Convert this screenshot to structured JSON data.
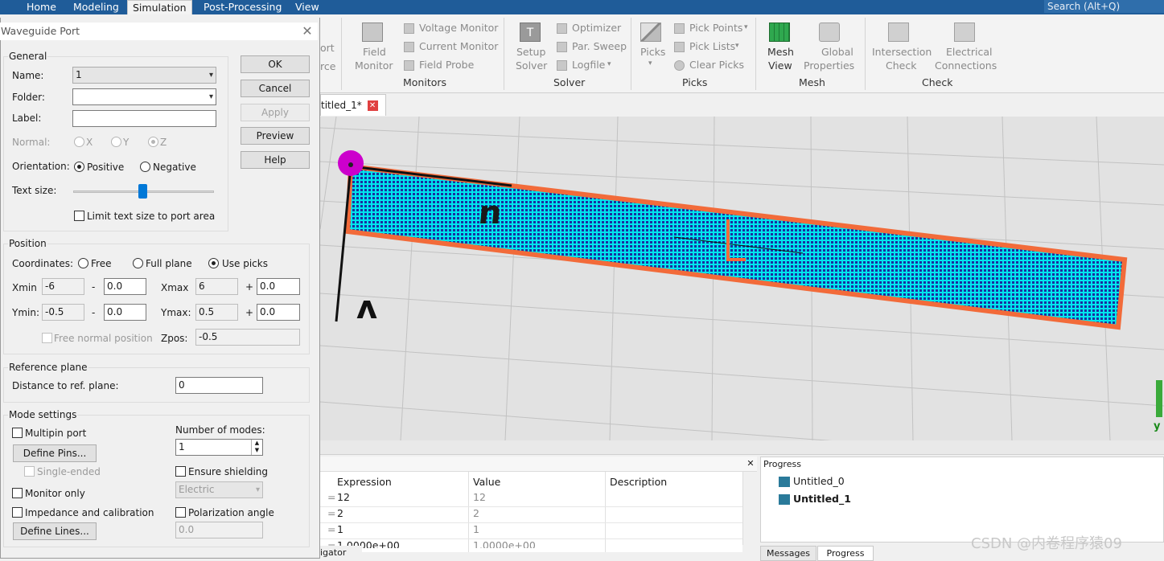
{
  "menubar": {
    "tabs": [
      "Home",
      "Modeling",
      "Simulation",
      "Post-Processing",
      "View"
    ],
    "active_tab": "Simulation",
    "search_placeholder": "Search (Alt+Q)"
  },
  "ribbon": {
    "partial": {
      "port": "ort",
      "source": "rce"
    },
    "field_monitor": {
      "line1": "Field",
      "line2": "Monitor"
    },
    "voltage_monitor": "Voltage Monitor",
    "current_monitor": "Current Monitor",
    "field_probe": "Field Probe",
    "monitors_group": "Monitors",
    "setup_solver": {
      "line1": "Setup",
      "line2": "Solver"
    },
    "optimizer": "Optimizer",
    "par_sweep": "Par. Sweep",
    "logfile": "Logfile",
    "solver_group": "Solver",
    "picks": "Picks",
    "pick_points": "Pick Points",
    "pick_lists": "Pick Lists",
    "clear_picks": "Clear Picks",
    "picks_group": "Picks",
    "mesh_view": {
      "line1": "Mesh",
      "line2": "View"
    },
    "global_properties": {
      "line1": "Global",
      "line2": "Properties"
    },
    "mesh_group": "Mesh",
    "intersection_check": {
      "line1": "Intersection",
      "line2": "Check"
    },
    "electrical_connections": {
      "line1": "Electrical",
      "line2": "Connections"
    },
    "check_group": "Check"
  },
  "document_tab": {
    "label": "titled_1*"
  },
  "viewport": {
    "port_label_n": "n",
    "port_label_wedge": "ʌ",
    "axis_y": "y"
  },
  "dialog": {
    "title": "Waveguide Port",
    "buttons": {
      "ok": "OK",
      "cancel": "Cancel",
      "apply": "Apply",
      "preview": "Preview",
      "help": "Help"
    },
    "general": {
      "title": "General",
      "name_label": "Name:",
      "name_value": "1",
      "folder_label": "Folder:",
      "folder_value": "",
      "label_label": "Label:",
      "label_value": "",
      "normal_label": "Normal:",
      "normal_x": "X",
      "normal_y": "Y",
      "normal_z": "Z",
      "orientation_label": "Orientation:",
      "positive": "Positive",
      "negative": "Negative",
      "text_size_label": "Text size:",
      "text_size_level": 0.5,
      "limit_text": "Limit text size to port area"
    },
    "position": {
      "title": "Position",
      "coordinates_label": "Coordinates:",
      "free": "Free",
      "full_plane": "Full plane",
      "use_picks": "Use picks",
      "xmin_label": "Xmin",
      "xmin": "-6",
      "xmin_off": "0.0",
      "xmax_label": "Xmax",
      "xmax": "6",
      "xmax_off": "0.0",
      "ymin_label": "Ymin:",
      "ymin": "-0.5",
      "ymin_off": "0.0",
      "ymax_label": "Ymax:",
      "ymax": "0.5",
      "ymax_off": "0.0",
      "minus": "-",
      "plus": "+",
      "free_normal": "Free normal position",
      "zpos_label": "Zpos:",
      "zpos": "-0.5"
    },
    "reference": {
      "title": "Reference plane",
      "distance_label": "Distance to ref. plane:",
      "distance": "0"
    },
    "mode": {
      "title": "Mode settings",
      "multipin": "Multipin port",
      "define_pins": "Define Pins...",
      "single_ended": "Single-ended",
      "monitor_only": "Monitor only",
      "impedance": "Impedance and calibration",
      "define_lines": "Define Lines...",
      "number_of_modes_label": "Number of modes:",
      "number_of_modes": "1",
      "ensure_shielding": "Ensure shielding",
      "shielding_type": "Electric",
      "polarization_angle": "Polarization angle",
      "polarization_value": "0.0"
    }
  },
  "parameters": {
    "columns": [
      "Expression",
      "Value",
      "Description"
    ],
    "rows": [
      {
        "eq": "=",
        "expression": "12",
        "value": "12"
      },
      {
        "eq": "=",
        "expression": "2",
        "value": "2"
      },
      {
        "eq": "=",
        "expression": "1",
        "value": "1"
      },
      {
        "eq": "=",
        "expression": "1.0000e+00",
        "value": "1.0000e+00"
      }
    ],
    "navigator_tab": "igator"
  },
  "progress": {
    "title": "Progress",
    "items": [
      "Untitled_0",
      "Untitled_1"
    ],
    "tabs": [
      "Messages",
      "Progress"
    ]
  },
  "watermark": "CSDN @内卷程序猿09",
  "colors": {
    "accent": "#1f5c99",
    "port_fill": "#00e5ee",
    "port_border": "#f26b3a",
    "pick_marker": "#cc00cc"
  }
}
